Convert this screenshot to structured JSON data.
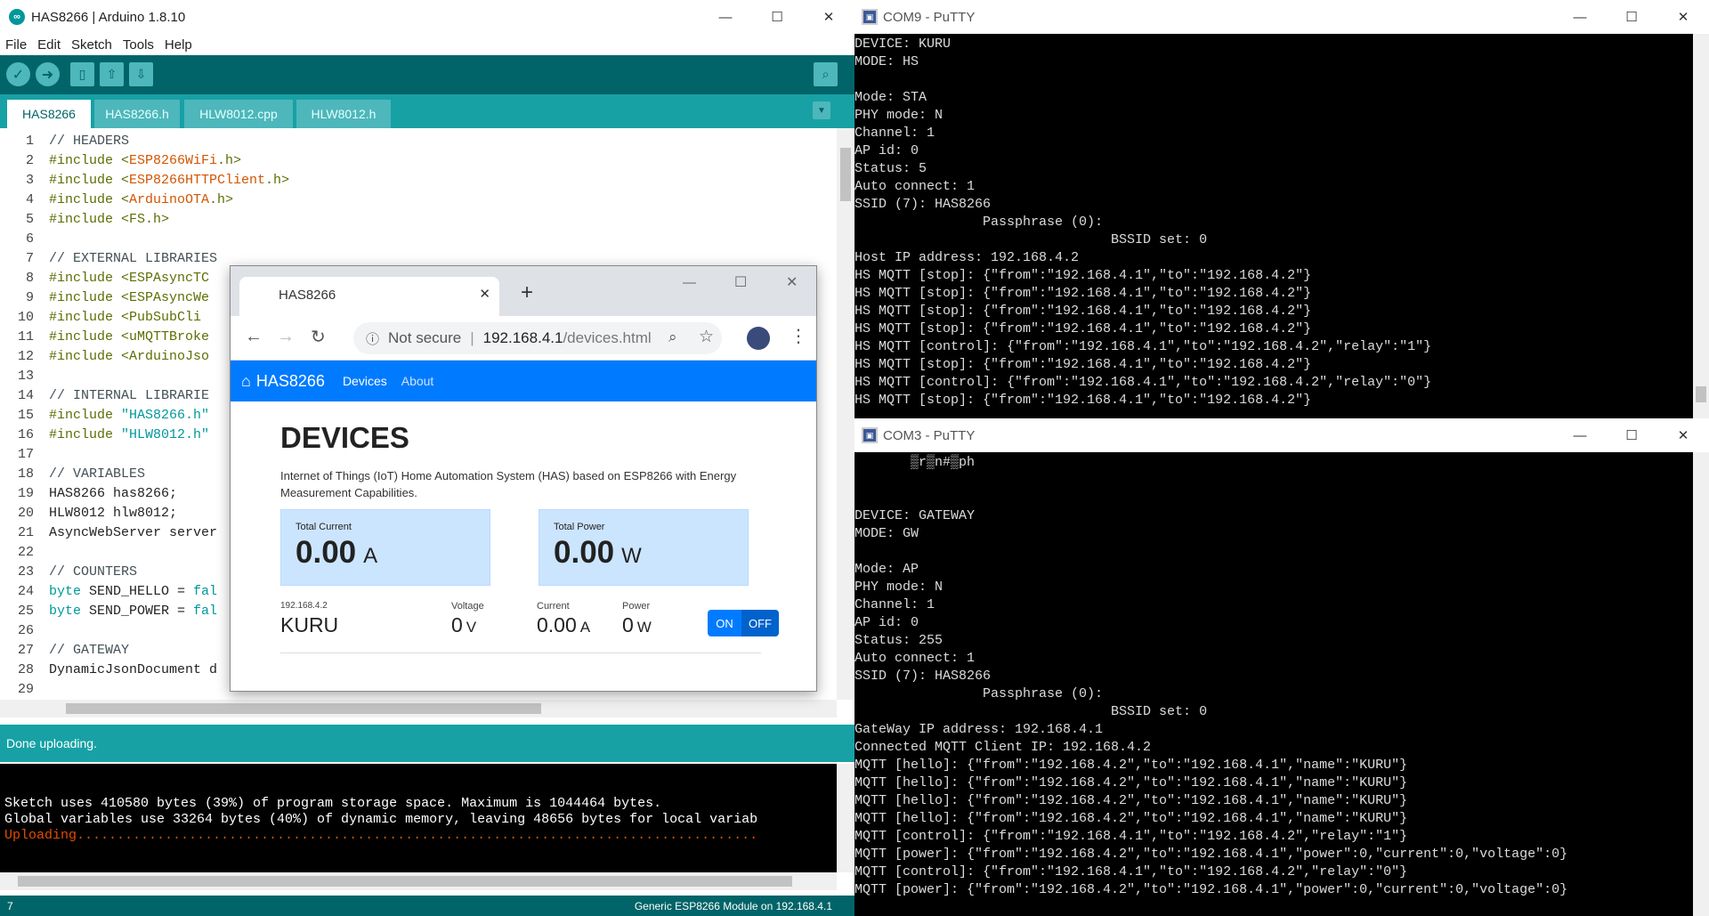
{
  "arduino": {
    "title": "HAS8266 | Arduino 1.8.10",
    "menu": [
      "File",
      "Edit",
      "Sketch",
      "Tools",
      "Help"
    ],
    "tabs": [
      "HAS8266",
      "HAS8266.h",
      "HLW8012.cpp",
      "HLW8012.h"
    ],
    "code_lines": [
      {
        "n": "1",
        "segs": [
          {
            "t": "// HEADERS",
            "c": "cm"
          }
        ]
      },
      {
        "n": "2",
        "segs": [
          {
            "t": "#include <",
            "c": "pp"
          },
          {
            "t": "ESP8266WiFi",
            "c": "lib"
          },
          {
            "t": ".h>",
            "c": "pp"
          }
        ]
      },
      {
        "n": "3",
        "segs": [
          {
            "t": "#include <",
            "c": "pp"
          },
          {
            "t": "ESP8266HTTPClient",
            "c": "lib"
          },
          {
            "t": ".h>",
            "c": "pp"
          }
        ]
      },
      {
        "n": "4",
        "segs": [
          {
            "t": "#include <",
            "c": "pp"
          },
          {
            "t": "ArduinoOTA",
            "c": "lib"
          },
          {
            "t": ".h>",
            "c": "pp"
          }
        ]
      },
      {
        "n": "5",
        "segs": [
          {
            "t": "#include <FS.h>",
            "c": "pp"
          }
        ]
      },
      {
        "n": "6",
        "segs": []
      },
      {
        "n": "7",
        "segs": [
          {
            "t": "// EXTERNAL LIBRARIES",
            "c": "cm"
          }
        ]
      },
      {
        "n": "8",
        "segs": [
          {
            "t": "#include <ESPAsyncTC",
            "c": "pp"
          }
        ]
      },
      {
        "n": "9",
        "segs": [
          {
            "t": "#include <ESPAsyncWe",
            "c": "pp"
          }
        ]
      },
      {
        "n": "10",
        "segs": [
          {
            "t": "#include <PubSubCli",
            "c": "pp"
          }
        ]
      },
      {
        "n": "11",
        "segs": [
          {
            "t": "#include <uMQTTBroke",
            "c": "pp"
          }
        ]
      },
      {
        "n": "12",
        "segs": [
          {
            "t": "#include <ArduinoJso",
            "c": "pp"
          }
        ]
      },
      {
        "n": "13",
        "segs": []
      },
      {
        "n": "14",
        "segs": [
          {
            "t": "// INTERNAL LIBRARIE",
            "c": "cm"
          }
        ]
      },
      {
        "n": "15",
        "segs": [
          {
            "t": "#include ",
            "c": "pp"
          },
          {
            "t": "\"HAS8266.h\"",
            "c": "kw"
          }
        ]
      },
      {
        "n": "16",
        "segs": [
          {
            "t": "#include ",
            "c": "pp"
          },
          {
            "t": "\"HLW8012.h\"",
            "c": "kw"
          }
        ]
      },
      {
        "n": "17",
        "segs": []
      },
      {
        "n": "18",
        "segs": [
          {
            "t": "// VARIABLES",
            "c": "cm"
          }
        ]
      },
      {
        "n": "19",
        "segs": [
          {
            "t": "HAS8266 has8266;",
            "c": ""
          }
        ]
      },
      {
        "n": "20",
        "segs": [
          {
            "t": "HLW8012 hlw8012;",
            "c": ""
          }
        ]
      },
      {
        "n": "21",
        "segs": [
          {
            "t": "AsyncWebServer server",
            "c": ""
          }
        ]
      },
      {
        "n": "22",
        "segs": []
      },
      {
        "n": "23",
        "segs": [
          {
            "t": "// COUNTERS",
            "c": "cm"
          }
        ]
      },
      {
        "n": "24",
        "segs": [
          {
            "t": "byte",
            "c": "kw"
          },
          {
            "t": " SEND_HELLO = ",
            "c": ""
          },
          {
            "t": "fal",
            "c": "kw"
          }
        ]
      },
      {
        "n": "25",
        "segs": [
          {
            "t": "byte",
            "c": "kw"
          },
          {
            "t": " SEND_POWER = ",
            "c": ""
          },
          {
            "t": "fal",
            "c": "kw"
          }
        ]
      },
      {
        "n": "26",
        "segs": []
      },
      {
        "n": "27",
        "segs": [
          {
            "t": "// GATEWAY",
            "c": "cm"
          }
        ]
      },
      {
        "n": "28",
        "segs": [
          {
            "t": "DynamicJsonDocument d",
            "c": ""
          }
        ]
      },
      {
        "n": "29",
        "segs": []
      }
    ],
    "status": "Done uploading.",
    "console": [
      {
        "t": "Sketch uses 410580 bytes (39%) of program storage space. Maximum is 1044464 bytes.",
        "c": "#ffffff"
      },
      {
        "t": "Global variables use 33264 bytes (40%) of dynamic memory, leaving 48656 bytes for local variab",
        "c": "#ffffff"
      },
      {
        "t": "Uploading.....................................................................................",
        "c": "#e34c00"
      }
    ],
    "bottom_left": "7",
    "bottom_right": "Generic ESP8266 Module on 192.168.4.1"
  },
  "com9": {
    "title": "COM9 - PuTTY",
    "lines": [
      "DEVICE: KURU",
      "MODE: HS",
      "",
      "Mode: STA",
      "PHY mode: N",
      "Channel: 1",
      "AP id: 0",
      "Status: 5",
      "Auto connect: 1",
      "SSID (7): HAS8266",
      "                Passphrase (0):",
      "                                BSSID set: 0",
      "Host IP address: 192.168.4.2",
      "HS MQTT [stop]: {\"from\":\"192.168.4.1\",\"to\":\"192.168.4.2\"}",
      "HS MQTT [stop]: {\"from\":\"192.168.4.1\",\"to\":\"192.168.4.2\"}",
      "HS MQTT [stop]: {\"from\":\"192.168.4.1\",\"to\":\"192.168.4.2\"}",
      "HS MQTT [stop]: {\"from\":\"192.168.4.1\",\"to\":\"192.168.4.2\"}",
      "HS MQTT [control]: {\"from\":\"192.168.4.1\",\"to\":\"192.168.4.2\",\"relay\":\"1\"}",
      "HS MQTT [stop]: {\"from\":\"192.168.4.1\",\"to\":\"192.168.4.2\"}",
      "HS MQTT [control]: {\"from\":\"192.168.4.1\",\"to\":\"192.168.4.2\",\"relay\":\"0\"}",
      "HS MQTT [stop]: {\"from\":\"192.168.4.1\",\"to\":\"192.168.4.2\"}"
    ]
  },
  "com3": {
    "title": "COM3 - PuTTY",
    "lines": [
      "       ▒r▒n#▒ph",
      "",
      "",
      "DEVICE: GATEWAY",
      "MODE: GW",
      "",
      "Mode: AP",
      "PHY mode: N",
      "Channel: 1",
      "AP id: 0",
      "Status: 255",
      "Auto connect: 1",
      "SSID (7): HAS8266",
      "                Passphrase (0):",
      "                                BSSID set: 0",
      "GateWay IP address: 192.168.4.1",
      "Connected MQTT Client IP: 192.168.4.2",
      "MQTT [hello]: {\"from\":\"192.168.4.2\",\"to\":\"192.168.4.1\",\"name\":\"KURU\"}",
      "MQTT [hello]: {\"from\":\"192.168.4.2\",\"to\":\"192.168.4.1\",\"name\":\"KURU\"}",
      "MQTT [hello]: {\"from\":\"192.168.4.2\",\"to\":\"192.168.4.1\",\"name\":\"KURU\"}",
      "MQTT [hello]: {\"from\":\"192.168.4.2\",\"to\":\"192.168.4.1\",\"name\":\"KURU\"}",
      "MQTT [control]: {\"from\":\"192.168.4.1\",\"to\":\"192.168.4.2\",\"relay\":\"1\"}",
      "MQTT [power]: {\"from\":\"192.168.4.2\",\"to\":\"192.168.4.1\",\"power\":0,\"current\":0,\"voltage\":0}",
      "MQTT [control]: {\"from\":\"192.168.4.1\",\"to\":\"192.168.4.2\",\"relay\":\"0\"}",
      "MQTT [power]: {\"from\":\"192.168.4.2\",\"to\":\"192.168.4.1\",\"power\":0,\"current\":0,\"voltage\":0}"
    ]
  },
  "chrome": {
    "tab_title": "HAS8266",
    "not_secure": "Not secure",
    "url_host": "192.168.4.1",
    "url_path": "/devices.html",
    "brand": "HAS8266",
    "nav_links": [
      "Devices",
      "About"
    ],
    "heading": "DEVICES",
    "description": "Internet of Things (IoT) Home Automation System (HAS) based on ESP8266 with Energy Measurement Capabilities.",
    "total_current_label": "Total Current",
    "total_current_value": "0.00",
    "total_current_unit": "A",
    "total_power_label": "Total Power",
    "total_power_value": "0.00",
    "total_power_unit": "W",
    "device": {
      "ip": "192.168.4.2",
      "name": "KURU",
      "voltage_label": "Voltage",
      "voltage_value": "0",
      "voltage_unit": "V",
      "current_label": "Current",
      "current_value": "0.00",
      "current_unit": "A",
      "power_label": "Power",
      "power_value": "0",
      "power_unit": "W",
      "on_label": "ON",
      "off_label": "OFF"
    }
  },
  "colors": {
    "arduino_dark": "#006468",
    "arduino_teal": "#17a1a5",
    "bootstrap_primary": "#007bff",
    "card_bg": "#cce5ff"
  }
}
